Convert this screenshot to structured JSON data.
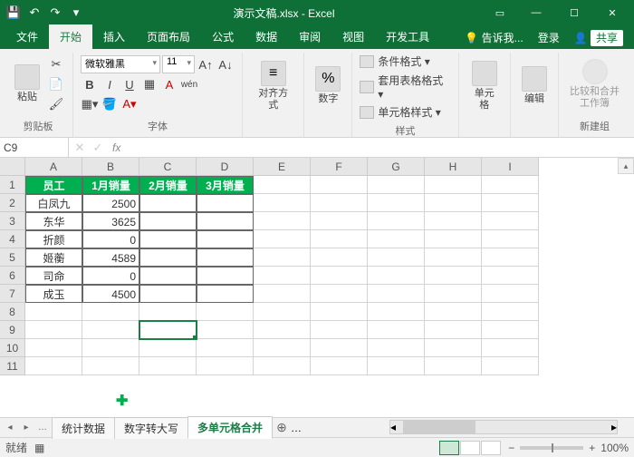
{
  "app": {
    "title": "演示文稿.xlsx - Excel"
  },
  "tabs": {
    "file": "文件",
    "home": "开始",
    "insert": "插入",
    "layout": "页面布局",
    "formula": "公式",
    "data": "数据",
    "review": "审阅",
    "view": "视图",
    "dev": "开发工具",
    "tell": "告诉我...",
    "login": "登录",
    "share": "共享"
  },
  "ribbon": {
    "clipboard": {
      "label": "剪贴板",
      "paste": "粘贴"
    },
    "font": {
      "label": "字体",
      "name": "微软雅黑",
      "size": "11",
      "bold": "B",
      "italic": "I",
      "underline": "U"
    },
    "align": {
      "label": "对齐方式"
    },
    "number": {
      "label": "数字",
      "sym": "%"
    },
    "styles": {
      "label": "样式",
      "cond": "条件格式 ▾",
      "table": "套用表格格式 ▾",
      "cell": "单元格样式 ▾"
    },
    "cells": {
      "label": "单元格"
    },
    "editing": {
      "label": "编辑"
    },
    "new": {
      "label": "新建组",
      "compare": "比较和合并\n工作簿"
    }
  },
  "formula": {
    "ref": "C9",
    "fx": "fx",
    "val": ""
  },
  "grid": {
    "cols": [
      "A",
      "B",
      "C",
      "D",
      "E",
      "F",
      "G",
      "H",
      "I"
    ],
    "rows": [
      "1",
      "2",
      "3",
      "4",
      "5",
      "6",
      "7",
      "8",
      "9",
      "10",
      "11"
    ],
    "headers": [
      "员工",
      "1月销量",
      "2月销量",
      "3月销量"
    ],
    "data": [
      [
        "白凤九",
        "2500",
        "",
        ""
      ],
      [
        "东华",
        "3625",
        "",
        ""
      ],
      [
        "折颜",
        "0",
        "",
        ""
      ],
      [
        "姬蘅",
        "4589",
        "",
        ""
      ],
      [
        "司命",
        "0",
        "",
        ""
      ],
      [
        "成玉",
        "4500",
        "",
        ""
      ]
    ]
  },
  "sheets": {
    "s1": "统计数据",
    "s2": "数字转大写",
    "s3": "多单元格合并"
  },
  "status": {
    "ready": "就绪",
    "zoom": "100%"
  }
}
